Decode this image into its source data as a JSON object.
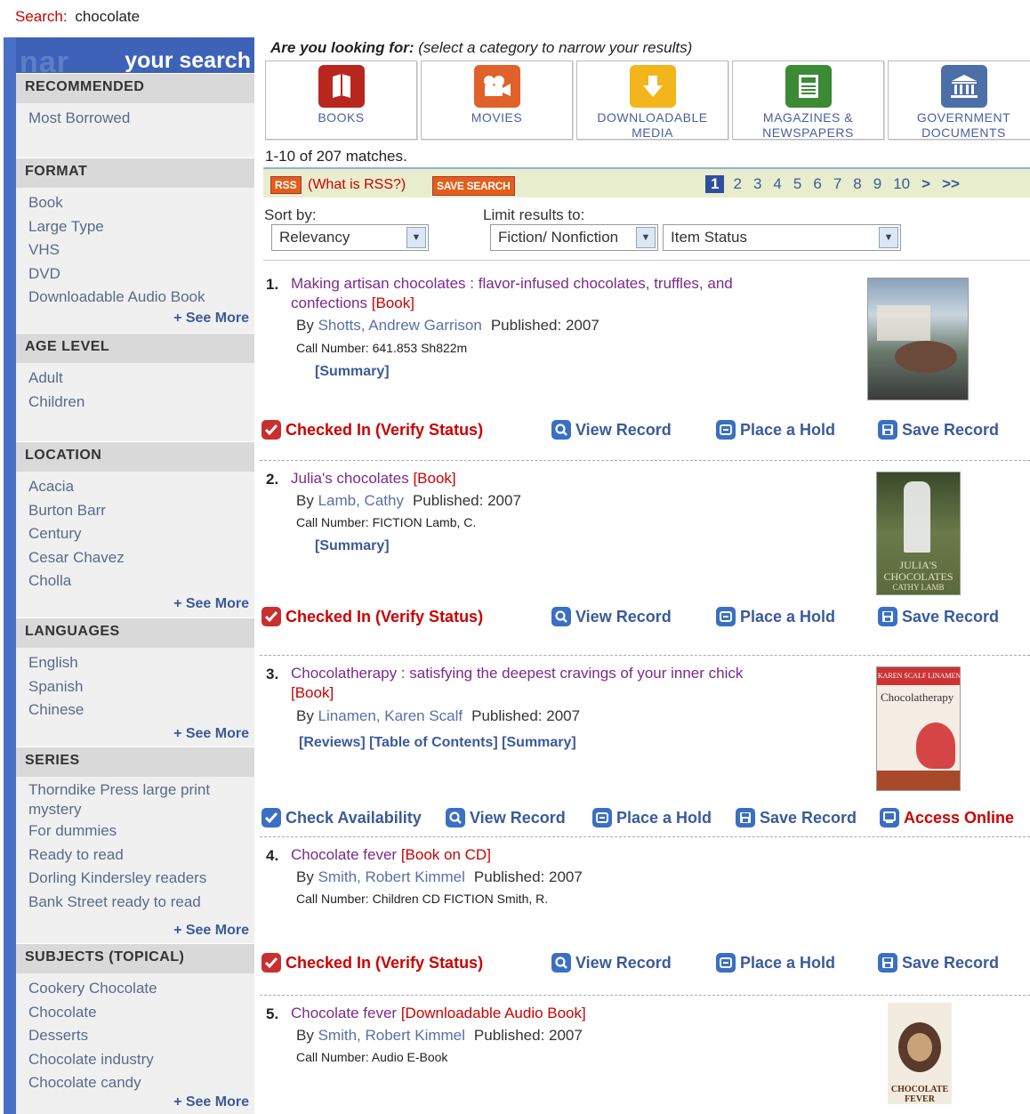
{
  "search": {
    "label": "Search:",
    "term": "chocolate"
  },
  "sidebar": {
    "ghost": "nar",
    "title": "your search",
    "facets": [
      {
        "name": "RECOMMENDED",
        "items": [
          "Most Borrowed"
        ],
        "see_more": ""
      },
      {
        "name": "FORMAT",
        "items": [
          "Book",
          "Large Type",
          "VHS",
          "DVD",
          "Downloadable Audio Book"
        ],
        "see_more": "+ See More"
      },
      {
        "name": "AGE LEVEL",
        "items": [
          "Adult",
          "Children"
        ],
        "see_more": ""
      },
      {
        "name": "LOCATION",
        "items": [
          "Acacia",
          "Burton Barr",
          "Century",
          "Cesar Chavez",
          "Cholla"
        ],
        "see_more": "+ See More"
      },
      {
        "name": "LANGUAGES",
        "items": [
          "English",
          "Spanish",
          "Chinese"
        ],
        "see_more": "+ See More"
      },
      {
        "name": "SERIES",
        "items": [
          "Thorndike Press large print",
          "mystery",
          "For dummies",
          "Ready to read",
          "Dorling Kindersley readers",
          "Bank Street ready to read"
        ],
        "see_more": "+ See More"
      },
      {
        "name": "SUBJECTS (TOPICAL)",
        "items": [
          "Cookery Chocolate",
          "Chocolate",
          "Desserts",
          "Chocolate industry",
          "Chocolate candy"
        ],
        "see_more": "+ See More"
      }
    ]
  },
  "looking": {
    "bold": "Are you looking for:",
    "rest": " (select a category to narrow your results)"
  },
  "categories": [
    {
      "label1": "BOOKS",
      "label2": "",
      "color": "#b8261e",
      "icon": "book-icon"
    },
    {
      "label1": "MOVIES",
      "label2": "",
      "color": "#e0612a",
      "icon": "movie-camera-icon"
    },
    {
      "label1": "DOWNLOADABLE",
      "label2": "MEDIA",
      "color": "#f2b51c",
      "icon": "download-arrow-icon"
    },
    {
      "label1": "MAGAZINES &",
      "label2": "NEWSPAPERS",
      "color": "#3b8a34",
      "icon": "newspaper-icon"
    },
    {
      "label1": "GOVERNMENT",
      "label2": "DOCUMENTS",
      "color": "#4d6fa8",
      "icon": "government-building-icon"
    }
  ],
  "matches": "1-10 of 207 matches.",
  "toolbar": {
    "rss": "RSS",
    "what_rss": "(What is RSS?)",
    "save_search": "SAVE SEARCH"
  },
  "pager": [
    "1",
    "2",
    "3",
    "4",
    "5",
    "6",
    "7",
    "8",
    "9",
    "10",
    ">",
    ">>"
  ],
  "sort": {
    "label": "Sort by:",
    "value": "Relevancy"
  },
  "limit": {
    "label": "Limit results to:",
    "fiction": "Fiction/ Nonfiction",
    "status": "Item Status"
  },
  "results": [
    {
      "num": "1.",
      "title": "Making artisan chocolates : flavor-infused chocolates, truffles, and confections",
      "fmt": "[Book]",
      "by": "By",
      "author": "Shotts, Andrew Garrison",
      "published": "Published: 2007",
      "call": "Call Number: 641.853 Sh822m",
      "links": "[Summary]",
      "actions": [
        "Checked In (Verify Status)",
        "View Record",
        "Place a Hold",
        "Save Record"
      ]
    },
    {
      "num": "2.",
      "title": "Julia's chocolates",
      "fmt": "[Book]",
      "by": "By",
      "author": "Lamb, Cathy",
      "published": "Published: 2007",
      "call": "Call Number: FICTION Lamb, C.",
      "links": "[Summary]",
      "cover_text": "JULIA'S CHOCOLATES",
      "cover_sub": "CATHY LAMB",
      "actions": [
        "Checked In (Verify Status)",
        "View Record",
        "Place a Hold",
        "Save Record"
      ]
    },
    {
      "num": "3.",
      "title": "Chocolatherapy : satisfying the deepest cravings of your inner chick",
      "fmt": "[Book]",
      "by": "By",
      "author": "Linamen, Karen Scalf",
      "published": "Published: 2007",
      "links": "[Reviews] [Table of Contents] [Summary]",
      "cover_text": "Chocolatherapy",
      "cover_top": "KAREN SCALF LINAMEN",
      "actions": [
        "Check Availability",
        "View Record",
        "Place a Hold",
        "Save Record",
        "Access Online"
      ]
    },
    {
      "num": "4.",
      "title": "Chocolate fever",
      "fmt": "[Book on CD]",
      "by": "By",
      "author": "Smith, Robert Kimmel",
      "published": "Published: 2007",
      "call": "Call Number: Children CD FICTION Smith, R.",
      "actions": [
        "Checked In (Verify Status)",
        "View Record",
        "Place a Hold",
        "Save Record"
      ]
    },
    {
      "num": "5.",
      "title": "Chocolate fever",
      "fmt": "[Downloadable Audio Book]",
      "by": "By",
      "author": "Smith, Robert Kimmel",
      "published": "Published: 2007",
      "call": "Call Number: Audio E-Book",
      "cover_text": "CHOCOLATE FEVER"
    }
  ]
}
